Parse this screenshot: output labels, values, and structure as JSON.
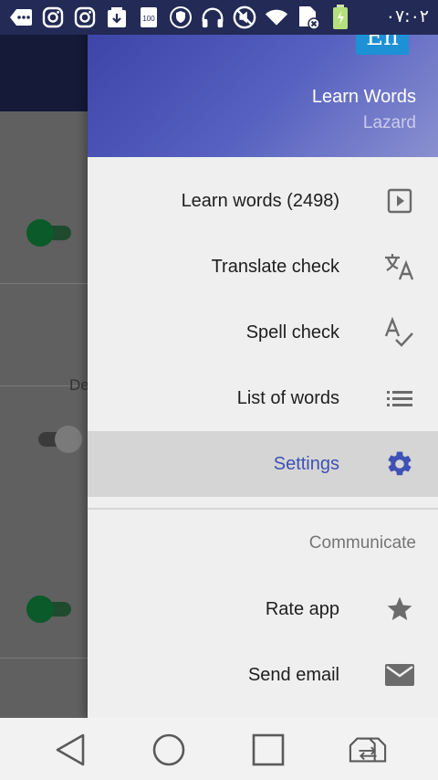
{
  "status_bar": {
    "time": "٠٧:٠٢",
    "icons": [
      "chat-icon",
      "instagram-icon",
      "instagram-icon",
      "download-icon",
      "storage-100-icon",
      "shield-icon",
      "headphones-icon",
      "mute-icon",
      "wifi-icon",
      "sim-icon",
      "battery-charging-icon"
    ]
  },
  "background": {
    "partial_text": "De"
  },
  "drawer": {
    "logo_text": "En",
    "title": "Learn Words",
    "subtitle": "Lazard",
    "items": [
      {
        "label": "Learn words (2498)",
        "icon": "play-box-icon"
      },
      {
        "label": "Translate check",
        "icon": "translate-icon"
      },
      {
        "label": "Spell check",
        "icon": "spellcheck-icon"
      },
      {
        "label": "List of words",
        "icon": "list-icon"
      },
      {
        "label": "Settings",
        "icon": "gear-icon",
        "active": true
      }
    ],
    "section_title": "Communicate",
    "communicate_items": [
      {
        "label": "Rate app",
        "icon": "star-icon"
      },
      {
        "label": "Send email",
        "icon": "mail-icon"
      }
    ],
    "accent_color": "#3f51b5"
  },
  "nav_bar": {
    "buttons": [
      "back-icon",
      "home-icon",
      "recents-icon",
      "switch-sim-icon"
    ]
  }
}
